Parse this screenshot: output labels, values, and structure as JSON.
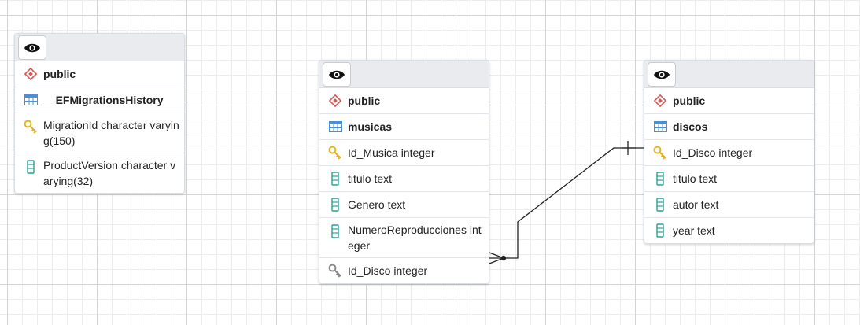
{
  "colors": {
    "schema_icon": "#d9534f",
    "table_icon": "#4a90d9",
    "key_icon": "#e6b422",
    "fk_icon": "#8a8a8a",
    "column_icon": "#2aa198"
  },
  "tables": [
    {
      "schema": "public",
      "name": "__EFMigrationsHistory",
      "columns": [
        {
          "icon": "primary-key-icon",
          "text": "MigrationId character varying(150)"
        },
        {
          "icon": "column-icon",
          "text": "ProductVersion character varying(32)"
        }
      ]
    },
    {
      "schema": "public",
      "name": "musicas",
      "columns": [
        {
          "icon": "primary-key-icon",
          "text": "Id_Musica integer"
        },
        {
          "icon": "column-icon",
          "text": "titulo text"
        },
        {
          "icon": "column-icon",
          "text": "Genero text"
        },
        {
          "icon": "column-icon",
          "text": "NumeroReproducciones integer"
        },
        {
          "icon": "foreign-key-icon",
          "text": "Id_Disco integer"
        }
      ]
    },
    {
      "schema": "public",
      "name": "discos",
      "columns": [
        {
          "icon": "primary-key-icon",
          "text": "Id_Disco integer"
        },
        {
          "icon": "column-icon",
          "text": "titulo text"
        },
        {
          "icon": "column-icon",
          "text": "autor text"
        },
        {
          "icon": "column-icon",
          "text": "year text"
        }
      ]
    }
  ],
  "relationships": [
    {
      "from": "musicas.Id_Disco",
      "to": "discos.Id_Disco",
      "from_cardinality": "many",
      "to_cardinality": "one"
    }
  ]
}
